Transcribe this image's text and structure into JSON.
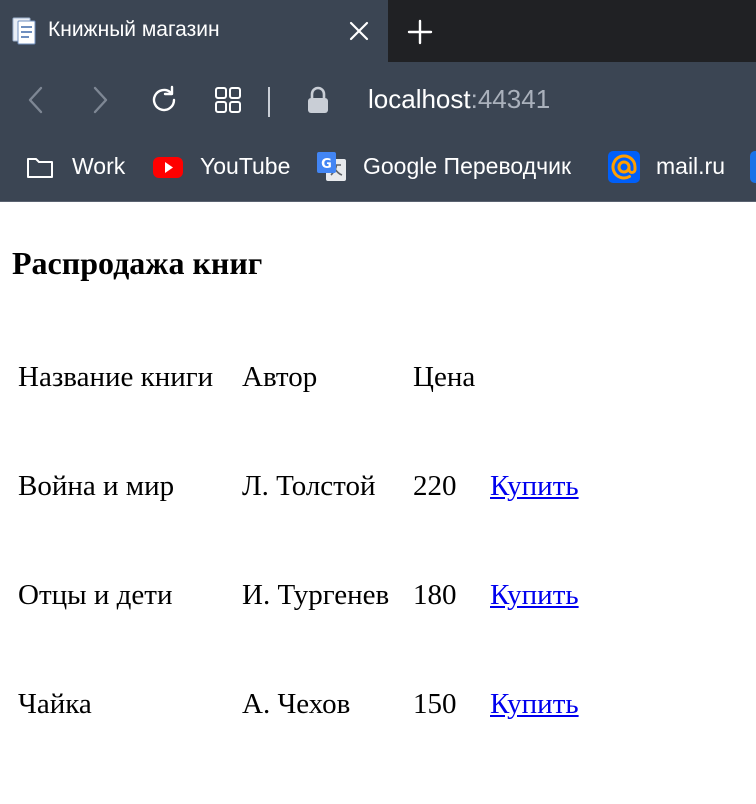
{
  "tab": {
    "title": "Книжный магазин",
    "favicon": "document-icon"
  },
  "address_bar": {
    "host": "localhost",
    "port": ":44341"
  },
  "bookmarks": [
    {
      "label": "Work",
      "icon": "folder-icon"
    },
    {
      "label": "YouTube",
      "icon": "youtube-icon"
    },
    {
      "label": "Google Переводчик",
      "icon": "google-translate-icon"
    },
    {
      "label": "mail.ru",
      "icon": "mailru-icon"
    }
  ],
  "page": {
    "title": "Распродажа книг",
    "table": {
      "headers": [
        "Название книги",
        "Автор",
        "Цена"
      ],
      "rows": [
        {
          "title": "Война и мир",
          "author": "Л. Толстой",
          "price": "220",
          "action": "Купить"
        },
        {
          "title": "Отцы и дети",
          "author": "И. Тургенев",
          "price": "180",
          "action": "Купить"
        },
        {
          "title": "Чайка",
          "author": "А. Чехов",
          "price": "150",
          "action": "Купить"
        }
      ]
    }
  },
  "colors": {
    "chrome": "#3b4553",
    "tabstrip": "#202124",
    "link": "#0000ee"
  }
}
